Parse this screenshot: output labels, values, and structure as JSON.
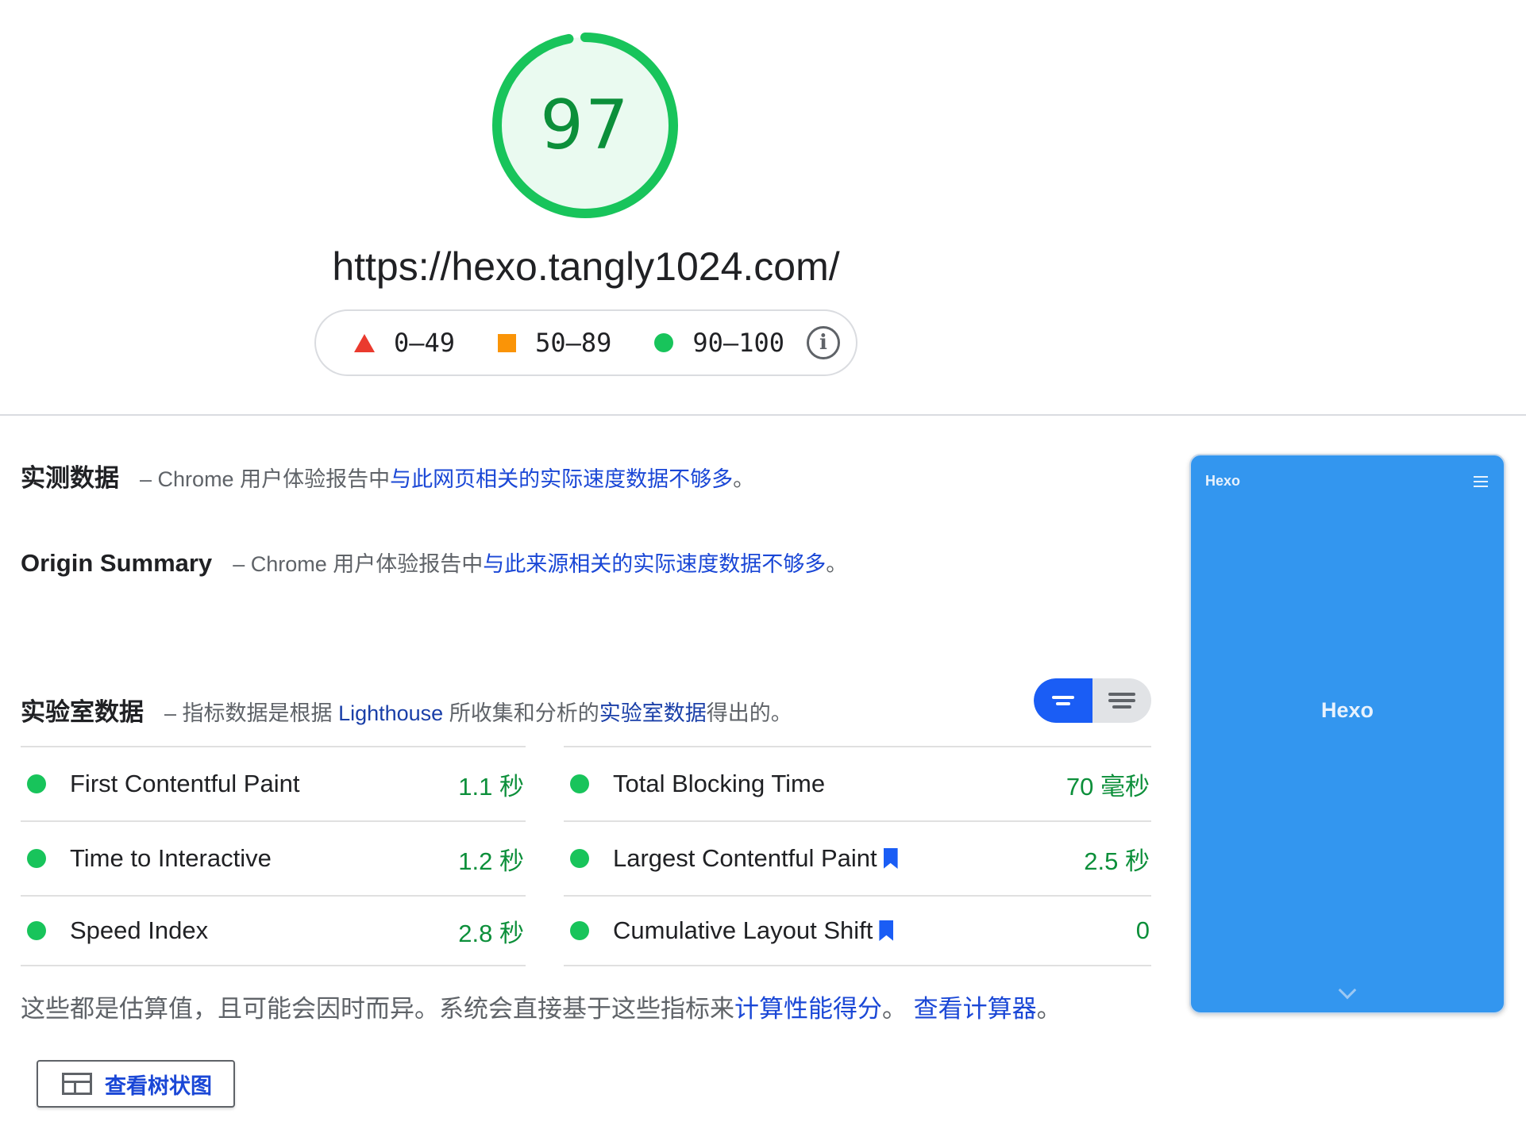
{
  "score": {
    "value": 97,
    "fraction": 0.97,
    "color": "#18c45b",
    "fill": "#eafaf0"
  },
  "url": "https://hexo.tangly1024.com/",
  "legend": {
    "items": [
      {
        "label": "0–49",
        "shape": "triangle",
        "color": "#ea3a2e"
      },
      {
        "label": "50–89",
        "shape": "square",
        "color": "#fa9407"
      },
      {
        "label": "90–100",
        "shape": "circle",
        "color": "#18c45b"
      }
    ],
    "info_icon": "info-icon"
  },
  "field_data": {
    "title": "实测数据",
    "dash": "–",
    "prefix": "Chrome 用户体验报告中",
    "link": "与此网页相关的实际速度数据不够多",
    "suffix": "。"
  },
  "origin_summary": {
    "title": "Origin Summary",
    "dash": "–",
    "prefix": "Chrome 用户体验报告中",
    "link": "与此来源相关的实际速度数据不够多",
    "suffix": "。"
  },
  "lab_data": {
    "title": "实验室数据",
    "dash": "–",
    "prefix": "指标数据是根据 ",
    "lighthouse": "Lighthouse",
    "middle": " 所收集和分析的",
    "link": "实验室数据",
    "suffix": "得出的。"
  },
  "view_toggle": {
    "active": "compact-view-icon",
    "inactive": "expanded-view-icon"
  },
  "metrics": {
    "left": [
      {
        "name": "First Contentful Paint",
        "value": "1.1 秒"
      },
      {
        "name": "Time to Interactive",
        "value": "1.2 秒"
      },
      {
        "name": "Speed Index",
        "value": "2.8 秒"
      }
    ],
    "right": [
      {
        "name": "Total Blocking Time",
        "value": "70 毫秒"
      },
      {
        "name": "Largest Contentful Paint",
        "value": "2.5 秒",
        "bookmark": true
      },
      {
        "name": "Cumulative Layout Shift",
        "value": "0",
        "bookmark": true
      }
    ]
  },
  "note": {
    "text": "这些都是估算值，且可能会因时而异。系统会直接基于这些指标来",
    "link1": "计算性能得分",
    "sep": "。 ",
    "link2": "查看计算器",
    "end": "。"
  },
  "treemap_button": {
    "label": "查看树状图",
    "icon": "treemap-icon"
  },
  "thumbnail": {
    "brand": "Hexo",
    "title": "Hexo",
    "background": "#3396ef"
  }
}
